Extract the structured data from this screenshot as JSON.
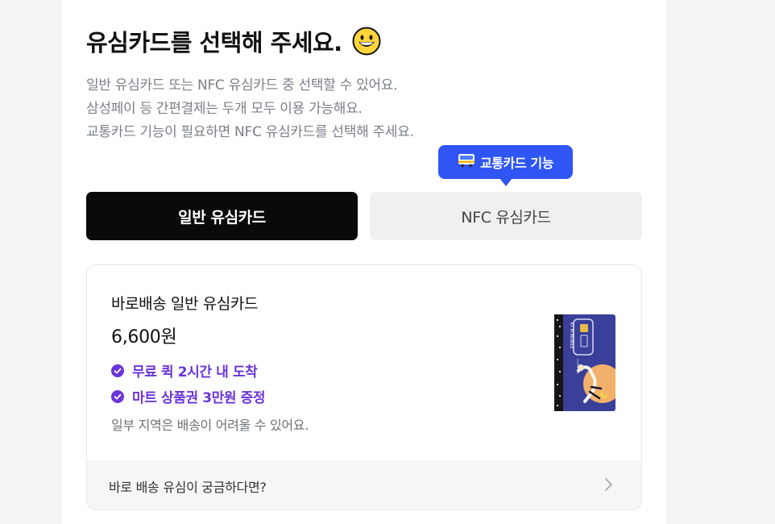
{
  "header": {
    "title": "유심카드를 선택해 주세요.",
    "title_emoji": "grinning-face-icon",
    "description": [
      "일반 유심카드 또는 NFC 유심카드 중 선택할 수 있어요.",
      "삼성페이 등 간편결제는 두개 모두 이용 가능해요.",
      "교통카드 기능이 필요하면 NFC 유심카드를 선택해 주세요."
    ]
  },
  "tooltip": {
    "label": "교통카드 기능",
    "icon": "bus-icon",
    "color": "#2f55f5"
  },
  "options": {
    "general": {
      "label": "일반 유심카드",
      "selected": true
    },
    "nfc": {
      "label": "NFC 유심카드",
      "selected": false
    }
  },
  "product": {
    "name": "바로배송 일반 유심카드",
    "price": "6,600원",
    "benefits": [
      "무료 퀵 2시간 내 도착",
      "마트 상품권 3만원 증정"
    ],
    "notice": "일부 지역은 배송이 어려울 수 있어요.",
    "image": {
      "brand_text": "KT M.MOBILE",
      "sub_text": "Mobile Life"
    },
    "faq_link": "바로 배송 유심이 궁금하다면?",
    "accent_color": "#6b35d8"
  }
}
